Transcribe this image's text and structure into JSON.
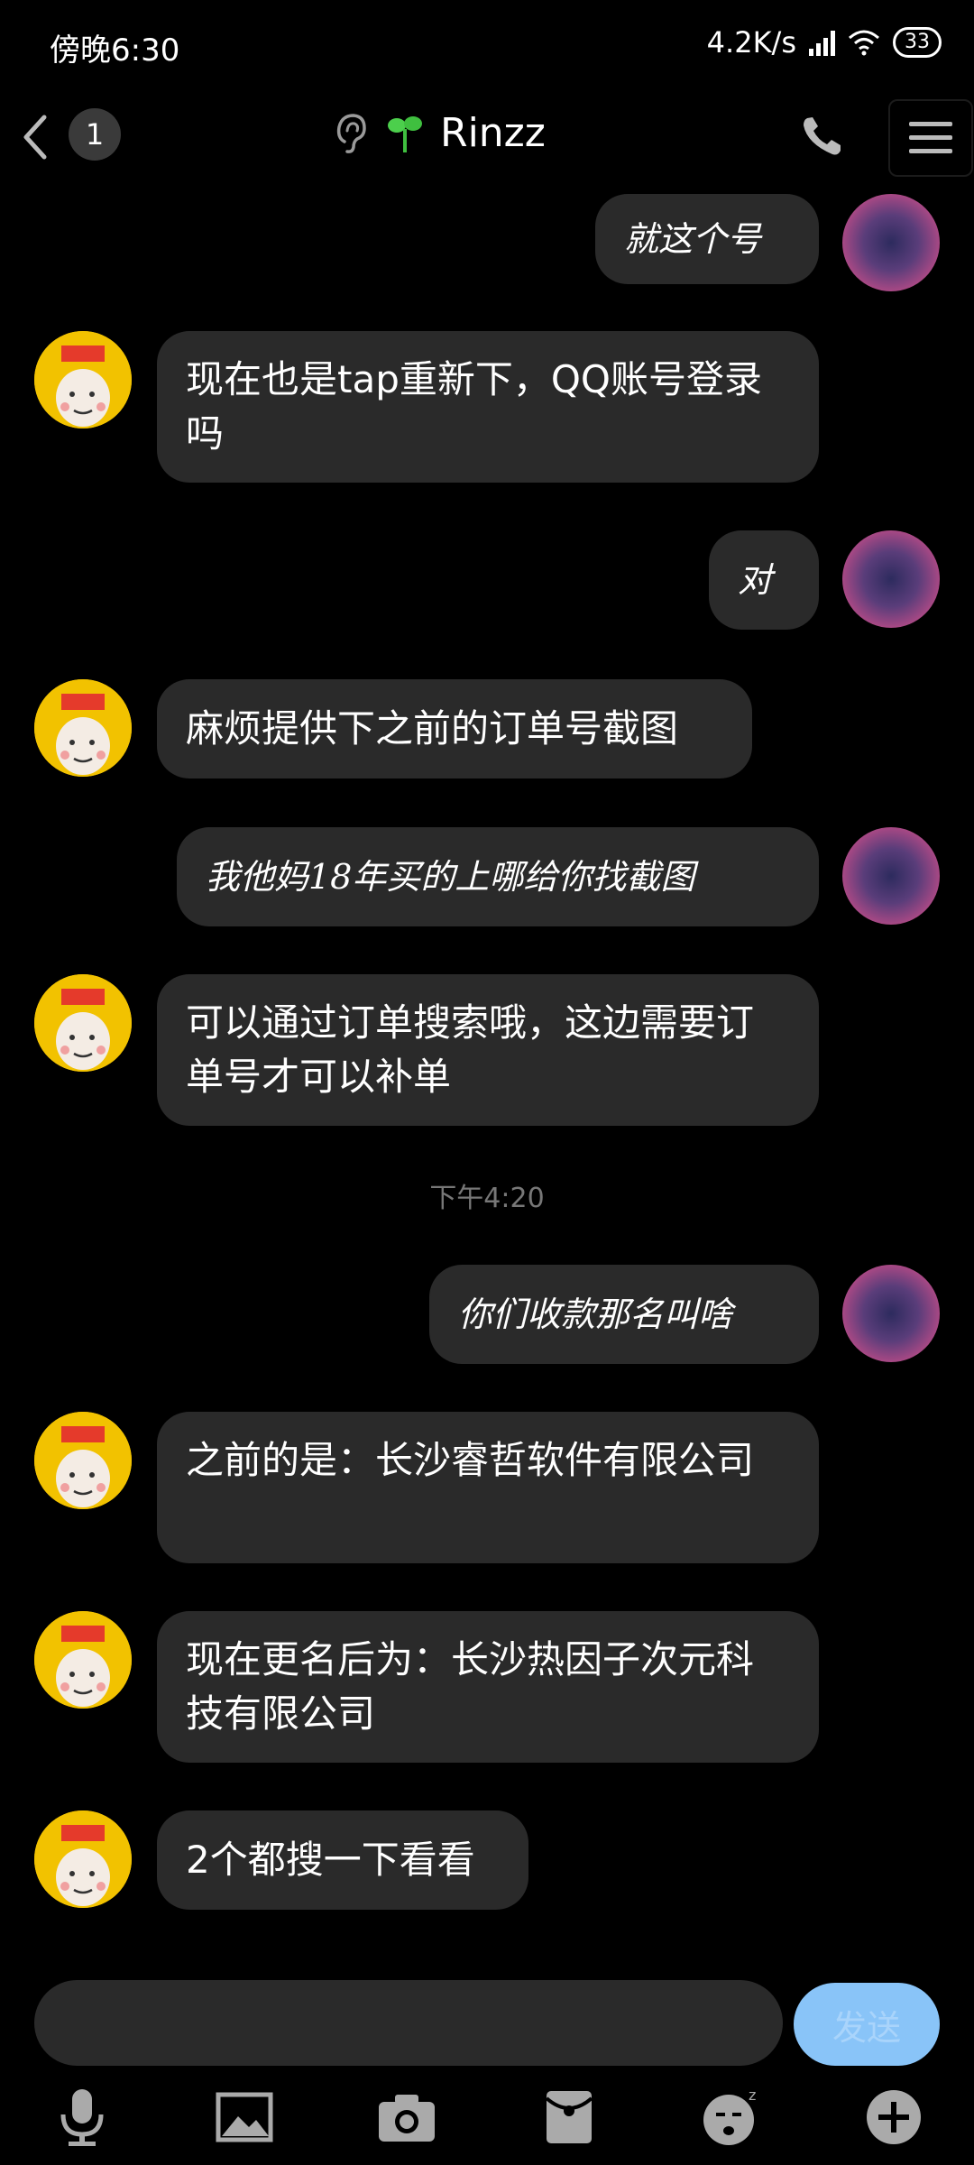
{
  "status_bar": {
    "time": "傍晚6:30",
    "network_speed": "4.2K/s",
    "battery": "33"
  },
  "header": {
    "unread_count": "1",
    "contact_name": "Rinzz",
    "icons": [
      "back-icon",
      "ear-icon",
      "sprout-icon",
      "phone-icon",
      "menu-icon"
    ]
  },
  "messages": [
    {
      "side": "right",
      "text": "就这个号"
    },
    {
      "side": "left",
      "text": "现在也是tap重新下，QQ账号登录吗"
    },
    {
      "side": "right",
      "text": "对"
    },
    {
      "side": "left",
      "text": "麻烦提供下之前的订单号截图"
    },
    {
      "side": "right",
      "text": "我他妈18年买的上哪给你找截图"
    },
    {
      "side": "left",
      "text": "可以通过订单搜索哦，这边需要订单号才可以补单"
    },
    {
      "side": "right",
      "text": "你们收款那名叫啥"
    },
    {
      "side": "left",
      "text": "之前的是：长沙睿哲软件有限公司"
    },
    {
      "side": "left",
      "text": "现在更名后为：长沙热因子次元科技有限公司"
    },
    {
      "side": "left",
      "text": "2个都搜一下看看"
    }
  ],
  "time_separator": "下午4:20",
  "input": {
    "value": "",
    "send_label": "发送"
  },
  "toolbar": {
    "items": [
      "microphone-icon",
      "image-icon",
      "camera-icon",
      "red-packet-icon",
      "emoji-icon",
      "plus-icon"
    ]
  }
}
